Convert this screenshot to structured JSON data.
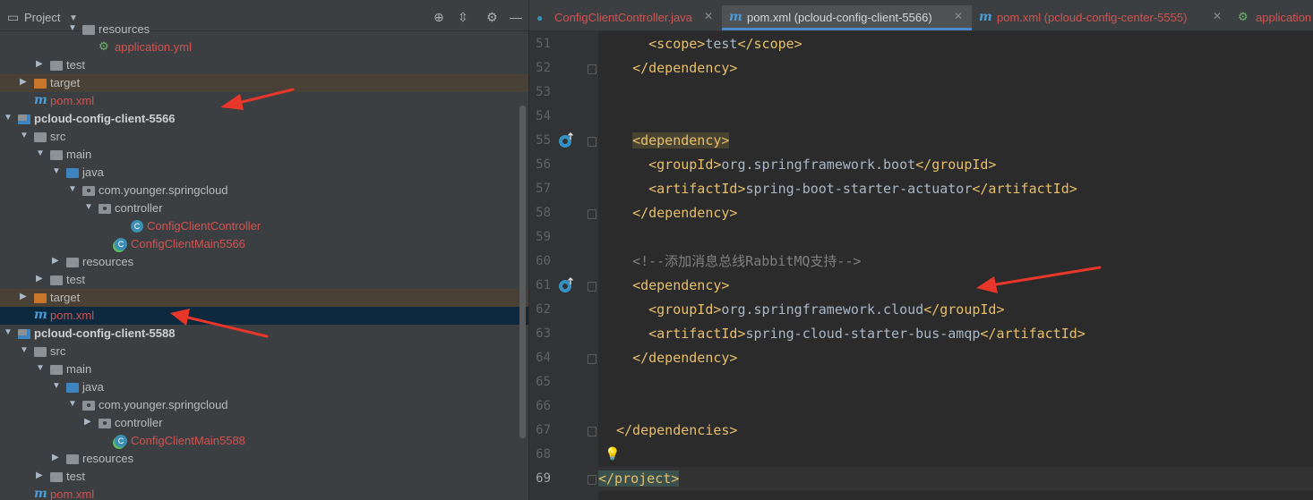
{
  "project_panel": {
    "title": "Project",
    "tree": [
      {
        "label": "resources",
        "level": 5,
        "type": "res-folder",
        "arrow": "down"
      },
      {
        "label": "application.yml",
        "level": 6,
        "type": "yml",
        "color": "red"
      },
      {
        "label": "test",
        "level": 3,
        "type": "folder",
        "arrow": "right"
      },
      {
        "label": "target",
        "level": 2,
        "type": "target-folder",
        "arrow": "right",
        "highlight": "target"
      },
      {
        "label": "pom.xml",
        "level": 2,
        "type": "maven",
        "color": "red"
      },
      {
        "label": "pcloud-config-client-5566",
        "level": 1,
        "type": "module",
        "arrow": "down",
        "bold": true
      },
      {
        "label": "src",
        "level": 2,
        "type": "folder",
        "arrow": "down"
      },
      {
        "label": "main",
        "level": 3,
        "type": "folder",
        "arrow": "down"
      },
      {
        "label": "java",
        "level": 4,
        "type": "src-folder",
        "arrow": "down"
      },
      {
        "label": "com.younger.springcloud",
        "level": 5,
        "type": "package",
        "arrow": "down"
      },
      {
        "label": "controller",
        "level": 6,
        "type": "package",
        "arrow": "down"
      },
      {
        "label": "ConfigClientController",
        "level": 8,
        "type": "class",
        "color": "red"
      },
      {
        "label": "ConfigClientMain5566",
        "level": 7,
        "type": "spring-class",
        "color": "red"
      },
      {
        "label": "resources",
        "level": 4,
        "type": "res-folder",
        "arrow": "right"
      },
      {
        "label": "test",
        "level": 3,
        "type": "folder",
        "arrow": "right"
      },
      {
        "label": "target",
        "level": 2,
        "type": "target-folder",
        "arrow": "right",
        "highlight": "target"
      },
      {
        "label": "pom.xml",
        "level": 2,
        "type": "maven",
        "color": "red",
        "selected": true
      },
      {
        "label": "pcloud-config-client-5588",
        "level": 1,
        "type": "module",
        "arrow": "down",
        "bold": true
      },
      {
        "label": "src",
        "level": 2,
        "type": "folder",
        "arrow": "down"
      },
      {
        "label": "main",
        "level": 3,
        "type": "folder",
        "arrow": "down"
      },
      {
        "label": "java",
        "level": 4,
        "type": "src-folder",
        "arrow": "down"
      },
      {
        "label": "com.younger.springcloud",
        "level": 5,
        "type": "package",
        "arrow": "down"
      },
      {
        "label": "controller",
        "level": 6,
        "type": "package",
        "arrow": "right"
      },
      {
        "label": "ConfigClientMain5588",
        "level": 7,
        "type": "spring-class",
        "color": "red"
      },
      {
        "label": "resources",
        "level": 4,
        "type": "res-folder",
        "arrow": "right"
      },
      {
        "label": "test",
        "level": 3,
        "type": "folder",
        "arrow": "right"
      },
      {
        "label": "pom.xml",
        "level": 2,
        "type": "maven",
        "color": "red"
      }
    ]
  },
  "tabs": [
    {
      "label": "ConfigClientController.java",
      "icon": "class-icon",
      "active": false
    },
    {
      "label": "pom.xml (pcloud-config-client-5566)",
      "icon": "maven-icon",
      "active": true
    },
    {
      "label": "pom.xml (pcloud-config-center-5555)",
      "icon": "maven-icon",
      "active": false
    },
    {
      "label": "application",
      "icon": "yml-icon",
      "active": false
    }
  ],
  "editor": {
    "lines": [
      {
        "n": "51",
        "text": "    <scope>test</scope>"
      },
      {
        "n": "52",
        "text": "  </dependency>"
      },
      {
        "n": "53",
        "text": ""
      },
      {
        "n": "54",
        "text": ""
      },
      {
        "n": "55",
        "text": "  <dependency>"
      },
      {
        "n": "56",
        "text": "    <groupId>org.springframework.boot</groupId>"
      },
      {
        "n": "57",
        "text": "    <artifactId>spring-boot-starter-actuator</artifactId>"
      },
      {
        "n": "58",
        "text": "  </dependency>"
      },
      {
        "n": "59",
        "text": ""
      },
      {
        "n": "60",
        "text": "  <!--添加消息总线RabbitMQ支持-->"
      },
      {
        "n": "61",
        "text": "  <dependency>"
      },
      {
        "n": "62",
        "text": "    <groupId>org.springframework.cloud</groupId>"
      },
      {
        "n": "63",
        "text": "    <artifactId>spring-cloud-starter-bus-amqp</artifactId>"
      },
      {
        "n": "64",
        "text": "  </dependency>"
      },
      {
        "n": "65",
        "text": ""
      },
      {
        "n": "66",
        "text": ""
      },
      {
        "n": "67",
        "text": "</dependencies>"
      },
      {
        "n": "68",
        "text": ""
      },
      {
        "n": "69",
        "text": "</project>"
      }
    ]
  },
  "colors": {
    "tag": "#e8bf6a",
    "comment": "#808080",
    "text": "#a9b7c6",
    "red_file": "#d25252",
    "arrow": "#e8362a",
    "selection": "#0d293e"
  }
}
